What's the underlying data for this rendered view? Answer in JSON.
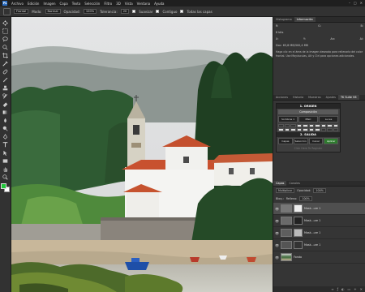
{
  "menu": {
    "logo": "Ps",
    "items": [
      "Archivo",
      "Edición",
      "Imagen",
      "Capa",
      "Texto",
      "Selección",
      "Filtro",
      "3D",
      "Vista",
      "Ventana",
      "Ayuda"
    ],
    "window_controls": [
      "–",
      "□",
      "✕"
    ]
  },
  "options": {
    "preset": "Frontal",
    "mode_label": "Modo:",
    "mode_value": "Normal",
    "opacity_label": "Opacidad:",
    "opacity_value": "100%",
    "tolerance_label": "Tolerancia:",
    "tolerance_value": "20",
    "smooth_label": "Suavizar",
    "contiguous_label": "Contiguo",
    "all_layers_label": "Todas las capas"
  },
  "toolbar": {
    "tools": [
      "move-icon",
      "marquee-icon",
      "lasso-icon",
      "quick-select-icon",
      "crop-icon",
      "eyedropper-icon",
      "healing-icon",
      "brush-icon",
      "stamp-icon",
      "history-brush-icon",
      "eraser-icon",
      "gradient-icon",
      "blur-icon",
      "dodge-icon",
      "pen-icon",
      "type-icon",
      "path-select-icon",
      "shape-icon",
      "hand-icon",
      "zoom-icon"
    ],
    "fg_color": "#20c93a",
    "bg_color": "#ffffff"
  },
  "info_panel": {
    "tabs": [
      "Histograma",
      "Información"
    ],
    "active_tab": "Información",
    "x_label": "X:",
    "y_label": "Y:",
    "w_label": "An:",
    "h_label": "Al:",
    "r_label": "R:",
    "g_label": "G:",
    "b_label": "B:",
    "bits_label": "8 bits",
    "doc_label": "Doc: 63,8 MB/300,4 MB",
    "description": "Haga clic en el área de la imagen deseada para rellenarla del color frontal. Use Mayúsculas, Alt y Ctrl para opciones adicionales."
  },
  "actions_panel": {
    "tabs": [
      "Acciones",
      "Historia",
      "Muestras",
      "Ajustes",
      "Propiedades",
      "TK Suite V6"
    ],
    "active_tab": "TK Suite V6",
    "title": "1. ORIGEN",
    "subtitle": "Composición",
    "row1": [
      "Sombras 1",
      "M&C",
      "Luces"
    ],
    "section2": "2. SALIDA",
    "footer_buttons": [
      "Capas",
      "Selección",
      "Canal",
      "Aplicar"
    ],
    "hint": "Click Here To Register"
  },
  "layers_panel": {
    "tabs": [
      "Capas",
      "Canales"
    ],
    "active_tab": "Capas",
    "blend_mode": "Multiplicar",
    "opacity_label": "Opacidad:",
    "opacity_value": "100%",
    "fill_label": "Relleno:",
    "fill_value": "100%",
    "lock_label": "Bloq.:",
    "layers": [
      {
        "name": "Mask...ure 1",
        "active": true
      },
      {
        "name": "Mask...ure 1",
        "active": false
      },
      {
        "name": "Mask...ure 1",
        "active": false
      },
      {
        "name": "Mask...ure 1",
        "active": false
      },
      {
        "name": "Fondo",
        "active": false
      }
    ]
  }
}
